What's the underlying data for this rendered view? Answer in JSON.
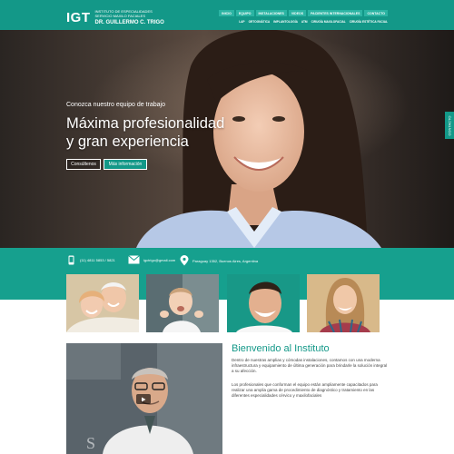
{
  "header": {
    "logo_mark": "IGT",
    "logo_line1": "INSTITUTO DE ESPECIALIDADES",
    "logo_line2": "SERVICIO MAXILO FACIALES",
    "logo_line3": "DR. GUILLERMO C. TRIGO",
    "nav": [
      "INICIO",
      "EQUIPO",
      "INSTALACIONES",
      "VIDEOS",
      "PACIENTES INTERNACIONALES",
      "CONTACTO"
    ],
    "subnav": [
      "LAP",
      "ORTOGNÁTICA",
      "IMPLANTOLOGÍA",
      "ATM",
      "CIRUGÍA MAXILOFACIAL",
      "CIRUGÍA ESTÉTICA FACIAL"
    ]
  },
  "hero": {
    "eyebrow": "Conozca nuestro equipo de trabajo",
    "title_line1": "Máxima profesionalidad",
    "title_line2": "y gran experiencia",
    "button_primary": "Consúltenos",
    "button_secondary": "Más información",
    "side_tab": "CONTACTO"
  },
  "contact": {
    "phone": "(11) 4811 5853 / 5821",
    "email": "igctrigo@gmail.com",
    "address": "Paraguay 1352, Buenos Aires, Argentina"
  },
  "welcome": {
    "title": "Bienvenido al Instituto",
    "paragraph1": "Dentro de nuestras amplias y cómodas instalaciones, contamos con una moderna infraestructura y equipamiento de última generación para brindarle la solución integral a su afección.",
    "paragraph2": "Los profesionales que conforman el equipo están ampliamente capacitados para realizar una amplia gama de procedimiento de diagnóstico y tratamiento en las diferentes especialidades cérvico y maxilofaciales"
  },
  "colors": {
    "brand": "#139888",
    "brand_light": "#2bb4a3"
  },
  "icons": [
    "phone-icon",
    "mail-icon",
    "location-pin-icon",
    "play-icon"
  ]
}
